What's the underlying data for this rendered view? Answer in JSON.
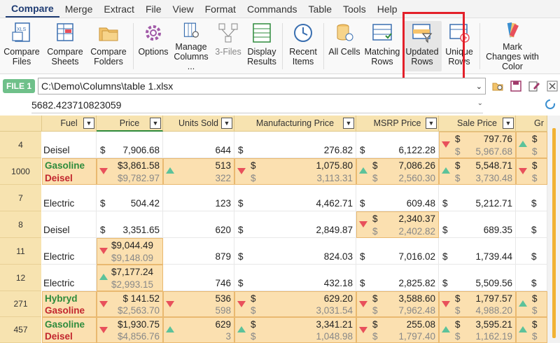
{
  "menu": [
    "Compare",
    "Merge",
    "Extract",
    "File",
    "View",
    "Format",
    "Commands",
    "Table",
    "Tools",
    "Help"
  ],
  "ribbon": {
    "compare_files": "Compare Files",
    "compare_sheets": "Compare Sheets",
    "compare_folders": "Compare Folders",
    "options": "Options",
    "manage_columns": "Manage Columns ...",
    "three_files": "3-Files",
    "display_results": "Display Results",
    "recent_items": "Recent Items",
    "all_cells": "All Cells",
    "matching_rows": "Matching Rows",
    "updated_rows": "Updated Rows",
    "unique_rows": "Unique Rows",
    "mark_changes": "Mark Changes with Color"
  },
  "file": {
    "badge": "FILE 1",
    "path": "C:\\Demo\\Columns\\table 1.xlsx"
  },
  "cell_value": "5682.423710823059",
  "columns": [
    "Fuel",
    "Price",
    "Units Sold",
    "Manufacturing Price",
    "MSRP Price",
    "Sale Price",
    "Gr"
  ],
  "rows": [
    {
      "num": "4",
      "fuel": "Deisel",
      "price": "7,906.68",
      "units": "644",
      "mfg": "276.82",
      "msrp": "6,122.28",
      "sale_new": "797.76",
      "sale_old": "5,967.68",
      "gr": "$",
      "gr2": "$"
    },
    {
      "num": "1000",
      "fuel_new": "Gasoline",
      "fuel_old": "Deisel",
      "price_new": "$3,861.58",
      "price_old": "$9,782.97",
      "units_new": "513",
      "units_old": "322",
      "mfg_new": "1,075.80",
      "mfg_old": "3,113.31",
      "msrp_new": "7,086.26",
      "msrp_old": "2,560.30",
      "sale_new": "5,548.71",
      "sale_old": "3,730.48",
      "gr": "$",
      "gr2": "$"
    },
    {
      "num": "7",
      "fuel": "Electric",
      "price": "504.42",
      "units": "123",
      "mfg": "4,462.71",
      "msrp": "609.48",
      "sale": "5,212.71",
      "gr": "$"
    },
    {
      "num": "8",
      "fuel": "Deisel",
      "price": "3,351.65",
      "units": "620",
      "mfg": "2,849.87",
      "msrp_new": "2,340.37",
      "msrp_old": "2,402.82",
      "sale": "689.35",
      "gr": "$"
    },
    {
      "num": "11",
      "fuel": "Electric",
      "price_new": "$9,044.49",
      "price_old": "$9,148.09",
      "units": "879",
      "mfg": "824.03",
      "msrp": "7,016.02",
      "sale": "1,739.44",
      "gr": "$"
    },
    {
      "num": "12",
      "fuel": "Electric",
      "price_new": "$7,177.24",
      "price_old": "$2,993.15",
      "units": "746",
      "mfg": "432.18",
      "msrp": "2,825.82",
      "sale": "5,509.56",
      "gr": "$"
    },
    {
      "num": "271",
      "fuel_new": "Hybryd",
      "fuel_old": "Gasoline",
      "price_new": "$ 141.52",
      "price_old": "$2,563.70",
      "units_new": "536",
      "units_old": "598",
      "mfg_new": "629.20",
      "mfg_old": "3,031.54",
      "msrp_new": "3,588.60",
      "msrp_old": "7,962.48",
      "sale_new": "1,797.57",
      "sale_old": "4,988.20",
      "gr": "$",
      "gr2": "$"
    },
    {
      "num": "457",
      "fuel_new": "Gasoline",
      "fuel_old": "Deisel",
      "price_new": "$1,930.75",
      "price_old": "$4,856.76",
      "units_new": "629",
      "units_old": "3",
      "mfg_new": "3,341.21",
      "mfg_old": "1,048.98",
      "msrp_new": "255.08",
      "msrp_old": "1,797.40",
      "sale_new": "3,595.21",
      "sale_old": "1,162.19",
      "gr": "$",
      "gr2": "$"
    }
  ],
  "dollar": "$",
  "dd_arrow": "▼"
}
